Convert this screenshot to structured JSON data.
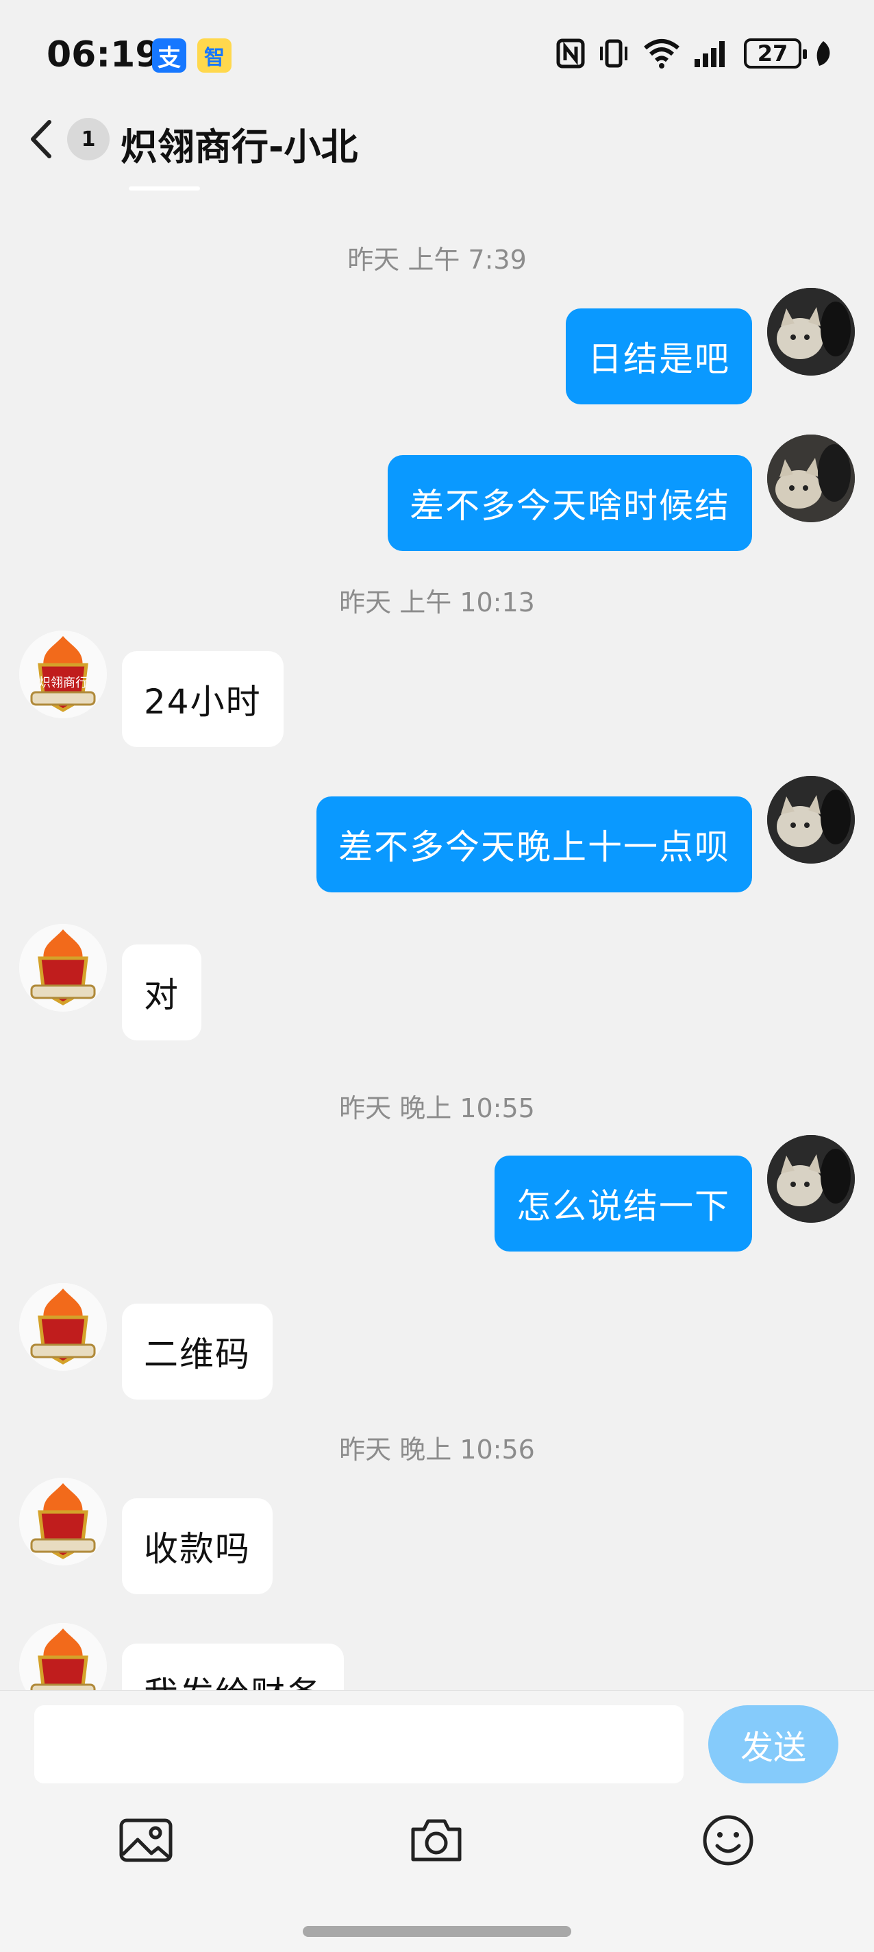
{
  "status_bar": {
    "time": "06:19",
    "alipay_glyph": "支",
    "gov_glyph": "智",
    "battery": "27",
    "icons": [
      "nfc-icon",
      "vibrate-icon",
      "wifi-icon",
      "signal-icon",
      "battery-icon",
      "leaf-icon"
    ]
  },
  "header": {
    "back_icon": "chevron-left-icon",
    "unread_count": "1",
    "title": "炽翎商行-小北"
  },
  "messages": {
    "ts1": "昨天 上午 7:39",
    "m1": "日结是吧",
    "m2": "差不多今天啥时候结",
    "ts2": "昨天 上午 10:13",
    "m3": "24小时",
    "m4": "差不多今天晚上十一点呗",
    "m5": "对",
    "ts3": "昨天 晚上 10:55",
    "m6": "怎么说结一下",
    "m7": "二维码",
    "ts4": "昨天 晚上 10:56",
    "m8": "收款吗",
    "m9": "我发给财务"
  },
  "avatar_badge_text": "炽翎商行",
  "composer": {
    "input_value": "",
    "send_label": "发送",
    "tools": [
      "image-icon",
      "camera-icon",
      "emoji-icon"
    ]
  },
  "colors": {
    "outgoing_bubble": "#0a99ff",
    "incoming_bubble": "#ffffff",
    "send_button": "#85cbfb",
    "background": "#f1f1f1"
  }
}
